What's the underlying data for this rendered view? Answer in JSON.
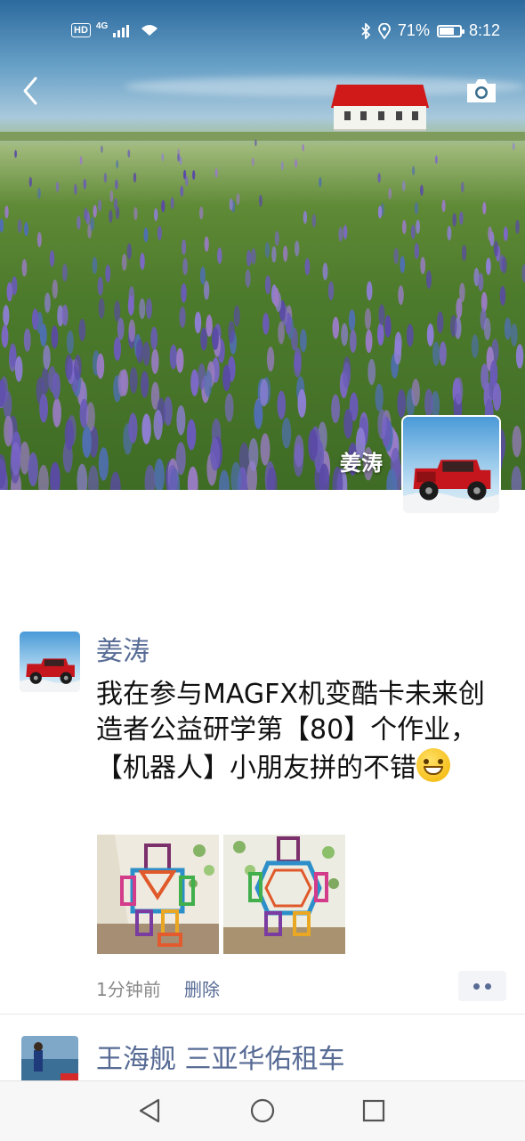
{
  "status_bar": {
    "hd": "HD",
    "network": "4G",
    "battery": "71%",
    "battery_level": 0.71,
    "time": "8:12",
    "icons": [
      "signal-icon",
      "wifi-icon",
      "bluetooth-icon",
      "location-icon",
      "battery-icon"
    ]
  },
  "header": {
    "back_icon": "chevron-left-icon",
    "camera_icon": "camera-icon"
  },
  "profile": {
    "name": "姜涛"
  },
  "post": {
    "author": "姜涛",
    "text": "我在参与MAGFX机变酷卡未来创造者公益研学第【80】个作业，【机器人】小朋友拼的不错",
    "emoji": "grinning-face-emoji",
    "photo_count": 2,
    "time": "1分钟前",
    "delete_label": "删除",
    "more_icon": "more-dots-icon"
  },
  "next_post": {
    "author": "王海舰 三亚华佑租车"
  },
  "nav_bar": {
    "icons": [
      "back-triangle-icon",
      "home-circle-icon",
      "recents-square-icon"
    ]
  },
  "colors": {
    "link_blue": "#576b95",
    "text": "#111111",
    "meta_gray": "#8a8a8a"
  }
}
